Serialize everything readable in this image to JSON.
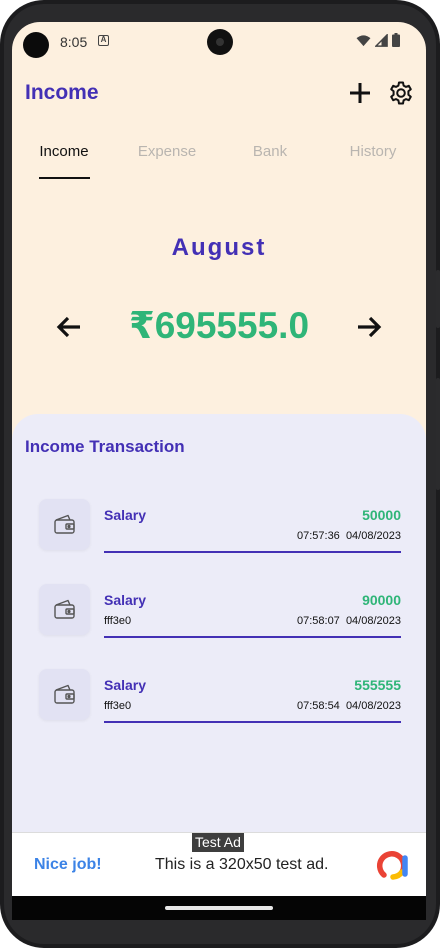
{
  "status_bar": {
    "time": "8:05",
    "notification_icon": "a-icon",
    "icons": [
      "wifi-icon",
      "signal-icon",
      "battery-icon"
    ]
  },
  "app_bar": {
    "title": "Income",
    "actions": [
      "plus-icon",
      "gear-icon"
    ]
  },
  "tabs": [
    {
      "label": "Income",
      "active": true
    },
    {
      "label": "Expense",
      "active": false
    },
    {
      "label": "Bank",
      "active": false
    },
    {
      "label": "History",
      "active": false
    }
  ],
  "summary": {
    "month": "August",
    "total": "₹695555.0",
    "prev_icon": "arrow-left-icon",
    "next_icon": "arrow-right-icon"
  },
  "transactions": {
    "title": "Income Transaction",
    "items": [
      {
        "label": "Salary",
        "amount": "50000",
        "note": "",
        "time": "07:57:36",
        "date": "04/08/2023",
        "icon": "wallet-icon"
      },
      {
        "label": "Salary",
        "amount": "90000",
        "note": "fff3e0",
        "time": "07:58:07",
        "date": "04/08/2023",
        "icon": "wallet-icon"
      },
      {
        "label": "Salary",
        "amount": "555555",
        "note": "fff3e0",
        "time": "07:58:54",
        "date": "04/08/2023",
        "icon": "wallet-icon"
      }
    ]
  },
  "ad": {
    "badge": "Test Ad",
    "headline": "Nice job!",
    "body": "This is a 320x50 test ad.",
    "logo_icon": "admob-logo-icon"
  },
  "colors": {
    "primary": "#4330b5",
    "positive": "#2fb578",
    "background": "#fdf0df",
    "panel": "#ececf8",
    "ad_link": "#3c83e6"
  }
}
